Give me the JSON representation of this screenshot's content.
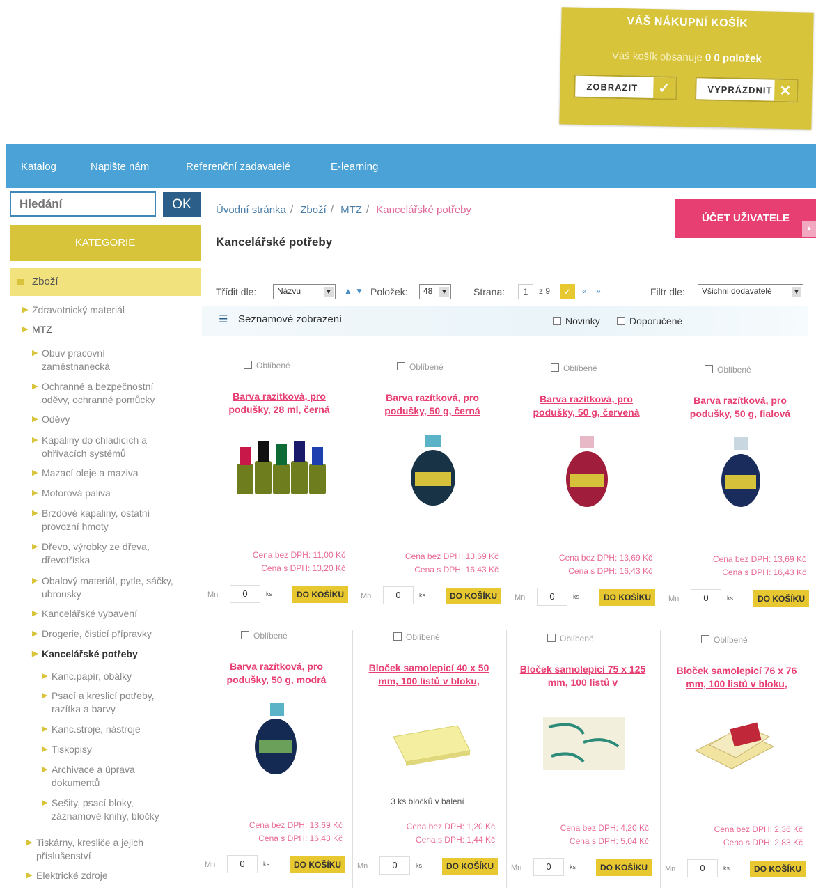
{
  "cart": {
    "title": "VÁŠ NÁKUPNÍ KOŠÍK",
    "info_prefix": "Váš košík obsahuje",
    "info_count": "0 0 položek",
    "show_label": "ZOBRAZIT",
    "empty_label": "VYPRÁZDNIT"
  },
  "nav": [
    "Katalog",
    "Napište nám",
    "Referenční zadavatelé",
    "E-learning"
  ],
  "search": {
    "placeholder": "Hledání",
    "ok": "OK"
  },
  "sidebar": {
    "kategorie": "KATEGORIE",
    "root": "Zboží",
    "items": [
      "Zdravotnický materiál",
      "MTZ",
      "Obuv pracovní zaměstnanecká",
      "Ochranné a bezpečnostní oděvy, ochranné pomůcky",
      "Oděvy",
      "Kapaliny do chladicích a ohřívacích systémů",
      "Mazací oleje a maziva",
      "Motorová paliva",
      "Brzdové kapaliny, ostatní provozní hmoty",
      "Dřevo, výrobky ze dřeva, dřevotříska",
      "Obalový materiál, pytle, sáčky, ubrousky",
      "Kancelářské vybavení",
      "Drogerie, čisticí přípravky",
      "Kancelářské potřeby",
      "Kanc.papír, obálky",
      "Psací a kreslicí potřeby, razítka a barvy",
      "Kanc.stroje, nástroje",
      "Tiskopisy",
      "Archivace a úprava dokumentů",
      "Sešity, psací bloky, záznamové knihy, bločky",
      "Tiskárny, kresliče a jejich příslušenství",
      "Elektrické zdroje"
    ]
  },
  "breadcrumb": [
    "Úvodní stránka",
    "Zboží",
    "MTZ",
    "Kancelářské potřeby"
  ],
  "page_title": "Kancelářské potřeby",
  "account": "ÚČET UŽIVATELE",
  "toolbar": {
    "sort_label": "Třídit dle:",
    "sort_value": "Názvu",
    "items_label": "Položek:",
    "items_value": "48",
    "page_label": "Strana:",
    "page_current": "1",
    "page_of": "z 9",
    "filter_label": "Filtr dle:",
    "filter_value": "Všichni dodavatelé"
  },
  "list_view": "Seznamové zobrazení",
  "flags": {
    "new": "Novinky",
    "recommended": "Doporučené"
  },
  "product_common": {
    "favorite": "Oblíbené",
    "price_excl": "Cena bez DPH:",
    "price_incl": "Cena s DPH:",
    "qty_label": "Mn",
    "qty_value": "0",
    "unit": "ks",
    "add": "DO KOŠÍKU"
  },
  "products": [
    {
      "name": "Barva razítková, pro podušky, 28 ml, černá",
      "excl": "11,00 Kč",
      "incl": "13,20 Kč",
      "note": ""
    },
    {
      "name": "Barva razítková, pro podušky, 50 g, černá",
      "excl": "13,69 Kč",
      "incl": "16,43 Kč",
      "note": ""
    },
    {
      "name": "Barva razítková, pro podušky, 50 g, červená",
      "excl": "13,69 Kč",
      "incl": "16,43 Kč",
      "note": ""
    },
    {
      "name": "Barva razítková, pro podušky, 50 g, fialová",
      "excl": "13,69 Kč",
      "incl": "16,43 Kč",
      "note": ""
    },
    {
      "name": "Barva razítková, pro podušky, 50 g, modrá",
      "excl": "13,69 Kč",
      "incl": "16,43 Kč",
      "note": ""
    },
    {
      "name": "Bloček samolepicí 40 x 50 mm, 100 listů v bloku,",
      "excl": "1,20 Kč",
      "incl": "1,44 Kč",
      "note": "3 ks bločků v balení"
    },
    {
      "name": "Bloček samolepicí 75 x 125 mm, 100 listů v",
      "excl": "4,20 Kč",
      "incl": "5,04 Kč",
      "note": ""
    },
    {
      "name": "Bloček samolepicí 76 x 76 mm, 100 listů v bloku,",
      "excl": "2,36 Kč",
      "incl": "2,83 Kč",
      "note": ""
    }
  ],
  "colors": {
    "accent": "#d8c43a",
    "nav": "#4aa2d6",
    "pink": "#e83f73",
    "button": "#e8c830"
  }
}
